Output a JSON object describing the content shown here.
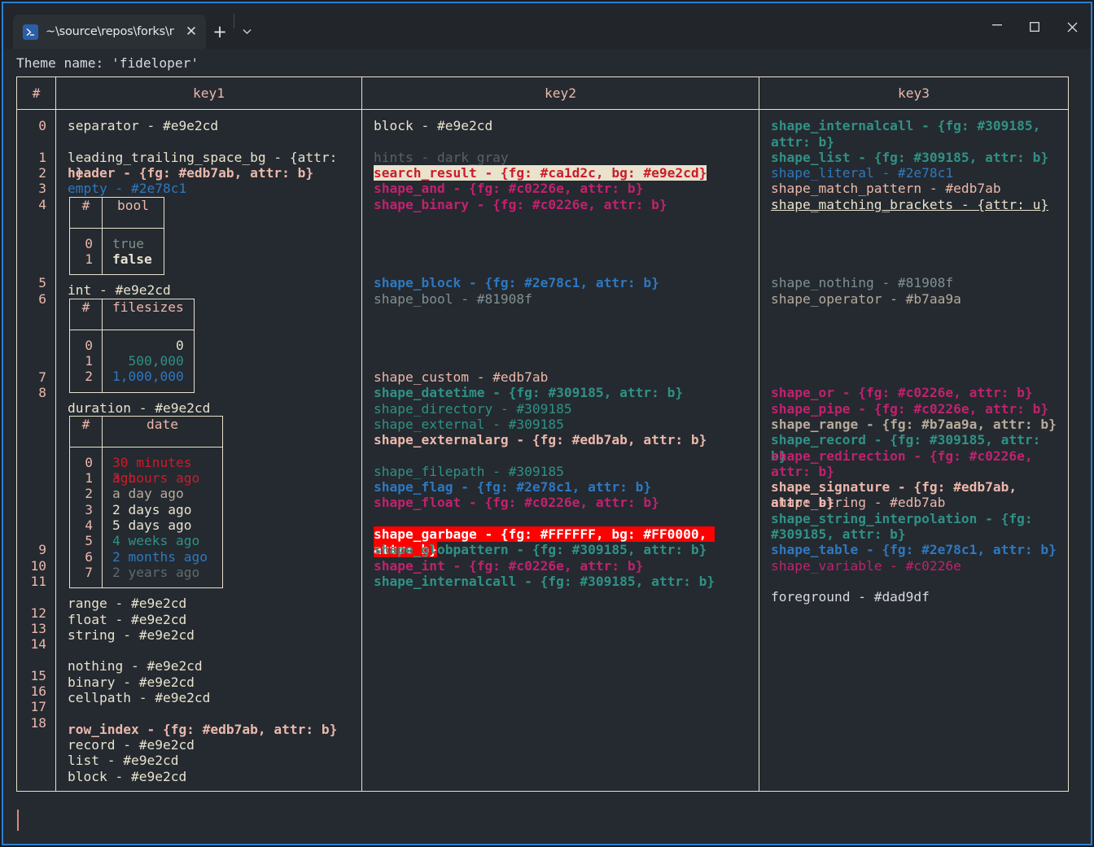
{
  "window": {
    "tab": {
      "icon": "powershell-icon",
      "icon_glyph": "∑",
      "title": "~\\source\\repos\\forks\\nu_scrip",
      "close_glyph": "✕"
    },
    "new_tab_glyph": "+",
    "dropdown_glyph": "⌄",
    "controls": {
      "minimize": "—",
      "maximize": "□",
      "close": "✕"
    },
    "accent_color": "#2a7fd4"
  },
  "terminal": {
    "theme_line": "Theme name: 'fideloper'",
    "cursor": "|",
    "colors": {
      "background": "#242a30",
      "border": "#e9e2cd",
      "header_fg": "#edb7ab",
      "foreground": "#dad9df",
      "teal": "#309185",
      "blue": "#2e78c1",
      "pink": "#c0226e",
      "gray": "#81908f",
      "warm_gray": "#b7aa9a",
      "salmon": "#edb7ab",
      "cream": "#e9e2cd",
      "red": "#ca1d2c",
      "dark_gray": "#5a6166"
    },
    "table": {
      "headers": [
        "#",
        "key1",
        "key2",
        "key3"
      ],
      "row_indices": [
        "0",
        "",
        "1",
        "2",
        "3",
        "4",
        "",
        "",
        "",
        "",
        "5",
        "6",
        "",
        "",
        "",
        "",
        "7",
        "8",
        "",
        "",
        "",
        "",
        "",
        "",
        "",
        "",
        "",
        "9",
        "10",
        "11",
        "",
        "12",
        "13",
        "14",
        "",
        "15",
        "16",
        "17",
        "18"
      ],
      "key1": [
        {
          "text": "separator - #e9e2cd",
          "color": "#e9e2cd"
        },
        {
          "text": "",
          "color": ""
        },
        {
          "text": "leading_trailing_space_bg - {attr: n}",
          "color": "#e9e2cd"
        },
        {
          "text": "header - {fg: #edb7ab, attr: b}",
          "color": "#edb7ab",
          "bold": true
        },
        {
          "text": "empty - #2e78c1",
          "color": "#2e78c1"
        }
      ],
      "key1_nested_bool": {
        "header": [
          "#",
          "bool"
        ],
        "rows": [
          {
            "idx": "0",
            "value": "true",
            "color": "#81908f"
          },
          {
            "idx": "1",
            "value": "false",
            "color": "#e9e2cd",
            "bold": true
          }
        ]
      },
      "key1_mid": [
        {
          "text": "int - #e9e2cd",
          "color": "#e9e2cd"
        }
      ],
      "key1_nested_filesizes": {
        "header": [
          "#",
          "filesizes"
        ],
        "rows": [
          {
            "idx": "0",
            "value": "0",
            "color": "#e9e2cd"
          },
          {
            "idx": "1",
            "value": "500,000",
            "color": "#309185"
          },
          {
            "idx": "2",
            "value": "1,000,000",
            "color": "#2e78c1"
          }
        ]
      },
      "key1_duration": [
        {
          "text": "duration - #e9e2cd",
          "color": "#e9e2cd"
        }
      ],
      "key1_nested_date": {
        "header": [
          "#",
          "date"
        ],
        "rows": [
          {
            "idx": "0",
            "value": "30 minutes ago",
            "color": "#ca1d2c"
          },
          {
            "idx": "1",
            "value": "3 hours ago",
            "color": "#ca1d2c"
          },
          {
            "idx": "2",
            "value": "a day ago",
            "color": "#b7aa9a"
          },
          {
            "idx": "3",
            "value": "2 days ago",
            "color": "#e9e2cd"
          },
          {
            "idx": "4",
            "value": "5 days ago",
            "color": "#e9e2cd"
          },
          {
            "idx": "5",
            "value": "4 weeks ago",
            "color": "#309185"
          },
          {
            "idx": "6",
            "value": "2 months ago",
            "color": "#2e78c1"
          },
          {
            "idx": "7",
            "value": "2 years ago",
            "color": "#5f6a6e"
          }
        ]
      },
      "key1_tail": [
        {
          "text": "range - #e9e2cd",
          "color": "#e9e2cd"
        },
        {
          "text": "float - #e9e2cd",
          "color": "#e9e2cd"
        },
        {
          "text": "string - #e9e2cd",
          "color": "#e9e2cd"
        },
        {
          "text": "",
          "color": ""
        },
        {
          "text": "nothing - #e9e2cd",
          "color": "#e9e2cd"
        },
        {
          "text": "binary - #e9e2cd",
          "color": "#e9e2cd"
        },
        {
          "text": "cellpath - #e9e2cd",
          "color": "#e9e2cd"
        },
        {
          "text": "",
          "color": ""
        },
        {
          "text": "row_index - {fg: #edb7ab, attr: b}",
          "color": "#edb7ab",
          "bold": true
        },
        {
          "text": "record - #e9e2cd",
          "color": "#e9e2cd"
        },
        {
          "text": "list - #e9e2cd",
          "color": "#e9e2cd"
        },
        {
          "text": "block - #e9e2cd",
          "color": "#e9e2cd"
        }
      ],
      "key2": [
        {
          "text": "block - #e9e2cd",
          "color": "#e9e2cd"
        },
        {
          "text": "",
          "color": ""
        },
        {
          "text": "hints - dark_gray",
          "color": "#5a6166"
        },
        {
          "text": "search_result - {fg: #ca1d2c, bg: #e9e2cd}",
          "highlight": "cream"
        },
        {
          "text": "shape_and - {fg: #c0226e, attr: b}",
          "color": "#c0226e",
          "bold": true
        },
        {
          "text": "shape_binary - {fg: #c0226e, attr: b}",
          "color": "#c0226e",
          "bold": true
        },
        {
          "text": "",
          "color": ""
        },
        {
          "text": "",
          "color": ""
        },
        {
          "text": "",
          "color": ""
        },
        {
          "text": "",
          "color": ""
        },
        {
          "text": "shape_block - {fg: #2e78c1, attr: b}",
          "color": "#2e78c1",
          "bold": true
        },
        {
          "text": "shape_bool - #81908f",
          "color": "#81908f"
        },
        {
          "text": "",
          "color": ""
        },
        {
          "text": "",
          "color": ""
        },
        {
          "text": "",
          "color": ""
        },
        {
          "text": "",
          "color": ""
        },
        {
          "text": "shape_custom - #edb7ab",
          "color": "#edb7ab"
        },
        {
          "text": "shape_datetime - {fg: #309185, attr: b}",
          "color": "#309185",
          "bold": true
        }
      ],
      "key2_tail": [
        {
          "text": "shape_directory - #309185",
          "color": "#309185"
        },
        {
          "text": "shape_external - #309185",
          "color": "#309185"
        },
        {
          "text": "shape_externalarg - {fg: #edb7ab, attr: b}",
          "color": "#edb7ab",
          "bold": true
        },
        {
          "text": "",
          "color": ""
        },
        {
          "text": "shape_filepath - #309185",
          "color": "#309185"
        },
        {
          "text": "shape_flag - {fg: #2e78c1, attr: b}",
          "color": "#2e78c1",
          "bold": true
        },
        {
          "text": "shape_float - {fg: #c0226e, attr: b}",
          "color": "#c0226e",
          "bold": true
        },
        {
          "text": "",
          "color": ""
        },
        {
          "text": "shape_garbage - {fg: #FFFFFF, bg: #FF0000, attr: b}",
          "highlight": "red"
        },
        {
          "text": "shape_globpattern - {fg: #309185, attr: b}",
          "color": "#309185",
          "bold": true
        },
        {
          "text": "shape_int - {fg: #c0226e, attr: b}",
          "color": "#c0226e",
          "bold": true
        },
        {
          "text": "shape_internalcall - {fg: #309185, attr: b}",
          "color": "#309185",
          "bold": true
        }
      ],
      "key3": [
        {
          "text": "shape_internalcall - {fg: #309185, attr: b}",
          "color": "#309185",
          "bold": true,
          "wrap": true
        },
        {
          "text": "shape_list - {fg: #309185, attr: b}",
          "color": "#309185",
          "bold": true
        },
        {
          "text": "shape_literal - #2e78c1",
          "color": "#2e78c1"
        },
        {
          "text": "shape_match_pattern - #edb7ab",
          "color": "#edb7ab"
        },
        {
          "text": "shape_matching_brackets - {attr: u}",
          "color": "#e9e2cd",
          "underline": true
        },
        {
          "text": "",
          "color": ""
        },
        {
          "text": "",
          "color": ""
        },
        {
          "text": "",
          "color": ""
        },
        {
          "text": "",
          "color": ""
        },
        {
          "text": "shape_nothing - #81908f",
          "color": "#81908f"
        },
        {
          "text": "shape_operator - #b7aa9a",
          "color": "#b7aa9a"
        },
        {
          "text": "",
          "color": ""
        },
        {
          "text": "",
          "color": ""
        },
        {
          "text": "",
          "color": ""
        },
        {
          "text": "",
          "color": ""
        },
        {
          "text": "",
          "color": ""
        },
        {
          "text": "shape_or - {fg: #c0226e, attr: b}",
          "color": "#c0226e",
          "bold": true
        },
        {
          "text": "shape_pipe - {fg: #c0226e, attr: b}",
          "color": "#c0226e",
          "bold": true
        }
      ],
      "key3_tail": [
        {
          "text": "shape_range - {fg: #b7aa9a, attr: b}",
          "color": "#b7aa9a",
          "bold": true
        },
        {
          "text": "shape_record - {fg: #309185, attr: b}",
          "color": "#309185",
          "bold": true
        },
        {
          "text": "shape_redirection - {fg: #c0226e, attr: b}",
          "color": "#c0226e",
          "bold": true,
          "wrap": true
        },
        {
          "text": "shape_signature - {fg: #edb7ab, attr: b}",
          "color": "#edb7ab",
          "bold": true
        },
        {
          "text": "shape_string - #edb7ab",
          "color": "#edb7ab"
        },
        {
          "text": "shape_string_interpolation - {fg: #309185, attr: b}",
          "color": "#309185",
          "bold": true,
          "wrap": true
        },
        {
          "text": "shape_table - {fg: #2e78c1, attr: b}",
          "color": "#2e78c1",
          "bold": true
        },
        {
          "text": "shape_variable - #c0226e",
          "color": "#c0226e"
        },
        {
          "text": "",
          "color": ""
        },
        {
          "text": "foreground - #dad9df",
          "color": "#dad9df"
        }
      ]
    }
  }
}
